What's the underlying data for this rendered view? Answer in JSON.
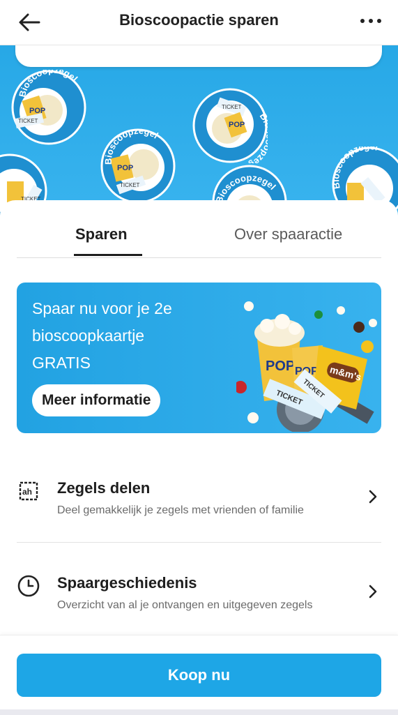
{
  "header": {
    "title": "Bioscoopactie sparen",
    "back_icon": "arrow-left-icon",
    "more_icon": "more-horizontal-icon"
  },
  "hero": {
    "sticker_text": "Bioscoopzegel",
    "ticket_text": "TICKET",
    "pop_text": "POP",
    "colors": {
      "background": "#2aa9e8",
      "sticker_yellow": "#f2c23a"
    }
  },
  "tabs": [
    {
      "label": "Sparen",
      "active": true
    },
    {
      "label": "Over spaaractie",
      "active": false
    }
  ],
  "promo": {
    "lines": [
      "Spaar nu voor je 2e",
      "bioscoopkaartje",
      "GRATIS"
    ],
    "button_label": "Meer informatie",
    "art": {
      "pop_text": "POP",
      "ticket_text": "TICKET",
      "mms_text": "m&m's"
    }
  },
  "list": [
    {
      "icon": "ah-stamp-icon",
      "title": "Zegels delen",
      "subtitle": "Deel gemakkelijk je zegels met vrienden of familie"
    },
    {
      "icon": "clock-icon",
      "title": "Spaargeschiedenis",
      "subtitle": "Overzicht van al je ontvangen en uitgegeven zegels"
    }
  ],
  "buy_button": {
    "label": "Koop nu"
  },
  "colors": {
    "primary": "#1ea6e6",
    "text": "#1e1e1e",
    "muted": "#6b6b6b"
  }
}
